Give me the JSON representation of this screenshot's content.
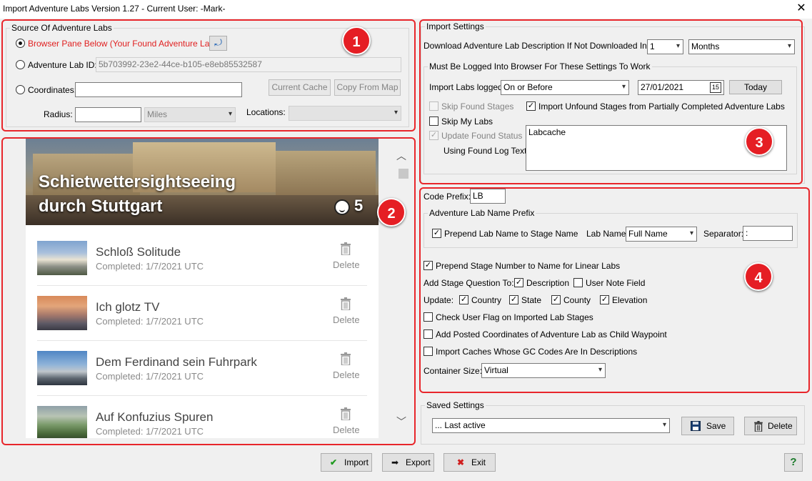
{
  "window": {
    "title": "Import Adventure Labs Version 1.27 - Current User: -Mark-",
    "close_glyph": "✕"
  },
  "source": {
    "legend": "Source Of Adventure Labs",
    "browser_label": "Browser Pane Below (Your Found Adventure Labs)",
    "lab_id_label": "Adventure Lab ID:",
    "lab_id_value": "5b703992-23e2-44ce-b105-e8eb85532587",
    "coordinates_label": "Coordinates:",
    "coordinates_value": "",
    "current_cache_btn": "Current Cache",
    "copy_from_map_btn": "Copy From Map",
    "radius_label": "Radius:",
    "radius_value": "",
    "radius_unit": "Miles",
    "locations_label": "Locations:",
    "locations_value": ""
  },
  "labs": {
    "banner_title_line1": "Schietwettersightseeing",
    "banner_title_line2": "durch Stuttgart",
    "banner_count": "5",
    "items": [
      {
        "name": "Schloß Solitude",
        "completed": "Completed: 1/7/2021 UTC",
        "delete": "Delete"
      },
      {
        "name": "Ich glotz TV",
        "completed": "Completed: 1/7/2021 UTC",
        "delete": "Delete"
      },
      {
        "name": "Dem Ferdinand sein Fuhrpark",
        "completed": "Completed: 1/7/2021 UTC",
        "delete": "Delete"
      },
      {
        "name": "Auf Konfuzius Spuren",
        "completed": "Completed: 1/7/2021 UTC",
        "delete": "Delete"
      }
    ]
  },
  "import_settings": {
    "legend": "Import Settings",
    "download_label": "Download Adventure Lab Description If Not Downloaded In Last",
    "download_count": "1",
    "download_unit": "Months",
    "logged_in_legend": "Must Be Logged Into Browser For These Settings To Work",
    "import_labs_logged_label": "Import Labs logged",
    "import_labs_logged_value": "On or Before",
    "date_value": "27/01/2021",
    "calendar_glyph": "15",
    "today_btn": "Today",
    "skip_found_label": "Skip Found Stages",
    "import_unfound_label": "Import Unfound Stages from Partially Completed Adventure Labs",
    "skip_my_labs_label": "Skip My Labs",
    "update_found_label": "Update Found Status",
    "found_log_label": "Using Found Log Text:",
    "found_log_text": "Labcache"
  },
  "naming": {
    "code_prefix_label": "Code Prefix:",
    "code_prefix_value": "LB",
    "name_prefix_legend": "Adventure Lab Name Prefix",
    "prepend_lab_name_label": "Prepend Lab Name to Stage Name",
    "lab_name_label": "Lab Name:",
    "lab_name_value": "Full Name",
    "separator_label": "Separator:",
    "separator_value": ":",
    "prepend_stage_number_label": "Prepend Stage Number to Name for Linear Labs",
    "add_question_label": "Add Stage Question To:",
    "description_label": "Description",
    "user_note_label": "User Note Field",
    "update_label": "Update:",
    "country_label": "Country",
    "state_label": "State",
    "county_label": "County",
    "elevation_label": "Elevation",
    "check_user_flag_label": "Check User Flag on Imported Lab Stages",
    "add_posted_coords_label": "Add Posted Coordinates of Adventure Lab as Child Waypoint",
    "import_gc_codes_label": "Import Caches Whose GC Codes Are In Descriptions",
    "container_size_label": "Container Size:",
    "container_size_value": "Virtual"
  },
  "saved": {
    "legend": "Saved Settings",
    "value": "... Last active",
    "save_btn": "Save",
    "delete_btn": "Delete"
  },
  "footer": {
    "import_btn": "Import",
    "export_btn": "Export",
    "exit_btn": "Exit",
    "help_glyph": "?"
  },
  "markers": {
    "one": "1",
    "two": "2",
    "three": "3",
    "four": "4"
  },
  "colors": {
    "annotation_red": "#e51e24",
    "accent_blue": "#1a5fb4"
  }
}
